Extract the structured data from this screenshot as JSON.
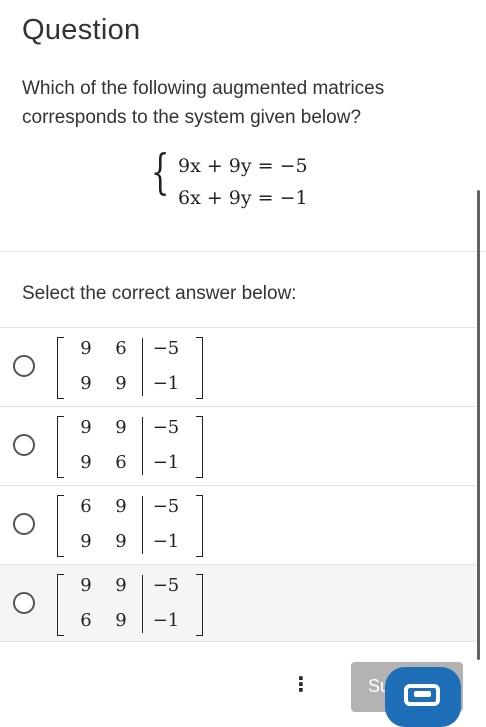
{
  "header": {
    "title": "Question"
  },
  "question": {
    "prompt": "Which of the following augmented matrices corresponds to the system given below?",
    "brace": "{",
    "equations": [
      "9x + 9y = −5",
      "6x + 9y = −1"
    ]
  },
  "instruction": "Select the correct answer below:",
  "options": [
    {
      "rows": [
        [
          "9",
          "6",
          "−5"
        ],
        [
          "9",
          "9",
          "−1"
        ]
      ],
      "selected": false
    },
    {
      "rows": [
        [
          "9",
          "9",
          "−5"
        ],
        [
          "9",
          "6",
          "−1"
        ]
      ],
      "selected": false
    },
    {
      "rows": [
        [
          "6",
          "9",
          "−5"
        ],
        [
          "9",
          "9",
          "−1"
        ]
      ],
      "selected": false
    },
    {
      "rows": [
        [
          "9",
          "9",
          "−5"
        ],
        [
          "6",
          "9",
          "−1"
        ]
      ],
      "selected": false
    }
  ],
  "footer": {
    "more_label": "⋮",
    "submit_label": "Su"
  },
  "colors": {
    "submit_bg": "#b3b3b3",
    "chat_bg": "#1e6fb8",
    "shaded_row": "#f5f5f5"
  },
  "icons": [
    "more-vertical-icon",
    "chat-icon",
    "radio-icon"
  ]
}
